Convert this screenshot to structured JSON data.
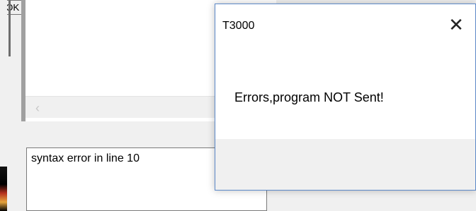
{
  "dialog": {
    "title": "T3000",
    "message": "Errors,program NOT Sent!",
    "ok_label": "OK",
    "close_icon": "close-icon"
  },
  "editor": {
    "scroll_left_icon": "chevron-left-icon"
  },
  "output": {
    "text": "syntax error in line 10"
  }
}
